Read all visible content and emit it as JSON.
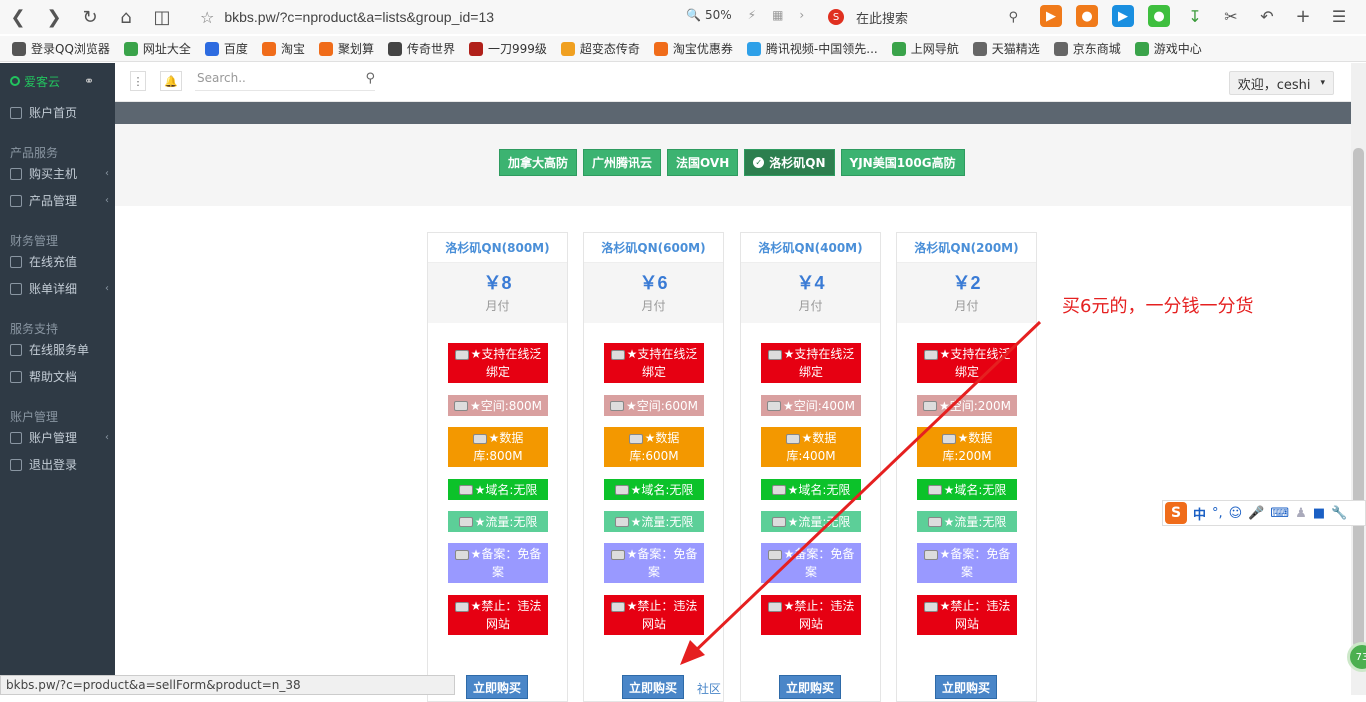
{
  "browser": {
    "url": "bkbs.pw/?c=nproduct&a=lists&group_id=13",
    "zoom": "50%",
    "search_text": "在此搜索",
    "status_url": "bkbs.pw/?c=product&a=sellForm&product=n_38"
  },
  "bookmarks": [
    {
      "label": "登录QQ浏览器",
      "color": "#555555"
    },
    {
      "label": "网址大全",
      "color": "#3aa34a"
    },
    {
      "label": "百度",
      "color": "#2d6be0"
    },
    {
      "label": "淘宝",
      "color": "#f06c1a"
    },
    {
      "label": "聚划算",
      "color": "#f06c1a"
    },
    {
      "label": "传奇世界",
      "color": "#444444"
    },
    {
      "label": "一刀999级",
      "color": "#b0201a"
    },
    {
      "label": "超变态传奇",
      "color": "#f0a020"
    },
    {
      "label": "淘宝优惠券",
      "color": "#f06c1a"
    },
    {
      "label": "腾讯视频-中国领先...",
      "color": "#2ea0e8"
    },
    {
      "label": "上网导航",
      "color": "#3aa34a"
    },
    {
      "label": "天猫精选",
      "color": "#666666"
    },
    {
      "label": "京东商城",
      "color": "#666666"
    },
    {
      "label": "游戏中心",
      "color": "#3aa34a"
    }
  ],
  "sidebar": {
    "logo": "爱客云",
    "items": [
      {
        "type": "item",
        "label": "账户首页",
        "arrow": false
      },
      {
        "type": "head",
        "label": "产品服务"
      },
      {
        "type": "item",
        "label": "购买主机",
        "arrow": true
      },
      {
        "type": "item",
        "label": "产品管理",
        "arrow": true
      },
      {
        "type": "head",
        "label": "财务管理"
      },
      {
        "type": "item",
        "label": "在线充值",
        "arrow": false
      },
      {
        "type": "item",
        "label": "账单详细",
        "arrow": true
      },
      {
        "type": "head",
        "label": "服务支持"
      },
      {
        "type": "item",
        "label": "在线服务单",
        "arrow": false
      },
      {
        "type": "item",
        "label": "帮助文档",
        "arrow": false
      },
      {
        "type": "head",
        "label": "账户管理"
      },
      {
        "type": "item",
        "label": "账户管理",
        "arrow": true
      },
      {
        "type": "item",
        "label": "退出登录",
        "arrow": false
      }
    ]
  },
  "header": {
    "search_placeholder": "Search..",
    "welcome": "欢迎，ceshi"
  },
  "tabs": [
    {
      "label": "加拿大高防",
      "active": false
    },
    {
      "label": "广州腾讯云",
      "active": false
    },
    {
      "label": "法国OVH",
      "active": false
    },
    {
      "label": "洛杉矶QN",
      "active": true
    },
    {
      "label": "YJN美国100G高防",
      "active": false
    }
  ],
  "products": [
    {
      "title": "洛杉矶QN(800M)",
      "price": "￥8",
      "period": "月付",
      "features": [
        "★支持在线泛绑定",
        "★空间:800M",
        "★数据库:800M",
        "★域名:无限",
        "★流量:无限",
        "★备案：免备案",
        "★禁止：违法网站"
      ],
      "buy": "立即购买"
    },
    {
      "title": "洛杉矶QN(600M)",
      "price": "￥6",
      "period": "月付",
      "features": [
        "★支持在线泛绑定",
        "★空间:600M",
        "★数据库:600M",
        "★域名:无限",
        "★流量:无限",
        "★备案：免备案",
        "★禁止：违法网站"
      ],
      "buy": "立即购买"
    },
    {
      "title": "洛杉矶QN(400M)",
      "price": "￥4",
      "period": "月付",
      "features": [
        "★支持在线泛绑定",
        "★空间:400M",
        "★数据库:400M",
        "★域名:无限",
        "★流量:无限",
        "★备案：免备案",
        "★禁止：违法网站"
      ],
      "buy": "立即购买"
    },
    {
      "title": "洛杉矶QN(200M)",
      "price": "￥2",
      "period": "月付",
      "features": [
        "★支持在线泛绑定",
        "★空间:200M",
        "★数据库:200M",
        "★域名:无限",
        "★流量:无限",
        "★备案：免备案",
        "★禁止：违法网站"
      ],
      "buy": "立即购买"
    }
  ],
  "feature_colors": [
    "#e60012",
    "#d9a0a0",
    "#f39800",
    "#0cc22a",
    "#5ccf98",
    "#9999ff",
    "#e60012"
  ],
  "annotation": "买6元的，一分钱一分货",
  "community_link": "社区",
  "ime": {
    "lang": "中",
    "punct": "°,",
    "badge": "73"
  }
}
